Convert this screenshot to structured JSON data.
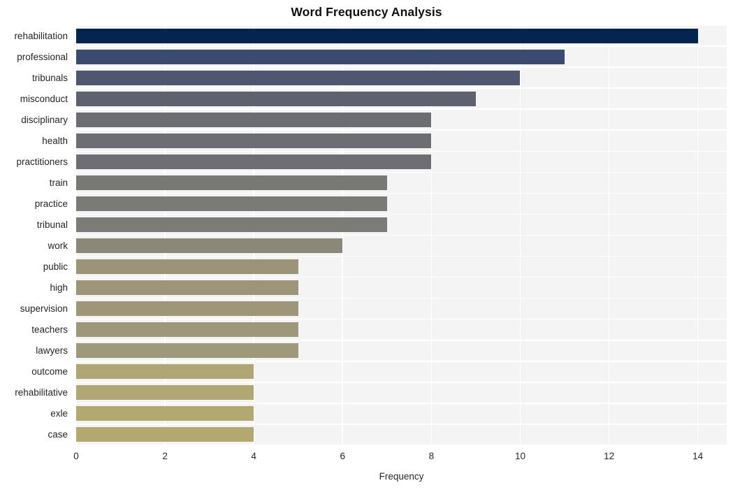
{
  "chart_data": {
    "type": "bar",
    "orientation": "horizontal",
    "title": "Word Frequency Analysis",
    "xlabel": "Frequency",
    "ylabel": "",
    "xlim": [
      0,
      14.65
    ],
    "xticks": [
      0,
      2,
      4,
      6,
      8,
      10,
      12,
      14
    ],
    "xtick_labels": [
      "0",
      "2",
      "4",
      "6",
      "8",
      "10",
      "12",
      "14"
    ],
    "grid": true,
    "legend": null,
    "categories": [
      "rehabilitation",
      "professional",
      "tribunals",
      "misconduct",
      "disciplinary",
      "health",
      "practitioners",
      "train",
      "practice",
      "tribunal",
      "work",
      "public",
      "high",
      "supervision",
      "teachers",
      "lawyers",
      "outcome",
      "rehabilitative",
      "exle",
      "case"
    ],
    "values": [
      14,
      11,
      10,
      9,
      8,
      8,
      8,
      7,
      7,
      7,
      6,
      5,
      5,
      5,
      5,
      5,
      4,
      4,
      4,
      4
    ],
    "bar_colors": [
      "#032550",
      "#3b4a70",
      "#4f5670",
      "#5e616e",
      "#6c6d72",
      "#6d6e73",
      "#6d6e73",
      "#787875",
      "#7a7a76",
      "#7c7b76",
      "#8b8779",
      "#9b9479",
      "#9c9579",
      "#9d9679",
      "#9e977a",
      "#9f987a",
      "#b0a673",
      "#b1a772",
      "#b2a871",
      "#b3a970"
    ]
  },
  "style": {
    "plot_background": "#f4f4f5",
    "gridline_color": "#ffffff",
    "figure_background": "#ffffff",
    "text_color": "#262626",
    "title_color": "#111111"
  }
}
